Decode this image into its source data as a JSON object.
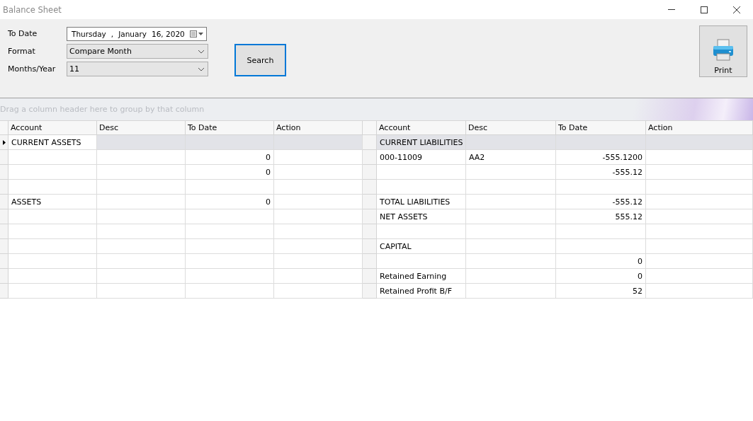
{
  "window": {
    "title": "Balance Sheet"
  },
  "filters": {
    "to_date": {
      "label": "To Date",
      "weekday": "Thursday",
      "separator": ",",
      "month": "January",
      "day_year": "16, 2020"
    },
    "format": {
      "label": "Format",
      "value": "Compare Month"
    },
    "months": {
      "label": "Months/Year",
      "value": "11"
    }
  },
  "search_button": {
    "label": "Search",
    "focused": true
  },
  "print_button": {
    "label": "Print"
  },
  "group_panel": {
    "placeholder": "Drag a column header here to group by that column"
  },
  "grids": [
    {
      "columns": [
        "Account",
        "Desc",
        "To Date",
        "Action"
      ],
      "focused": true,
      "rows": [
        {
          "selected": true,
          "account": "CURRENT ASSETS"
        },
        {
          "selected": false,
          "to_date": "0"
        },
        {
          "selected": false,
          "to_date": "0"
        },
        {
          "selected": false
        },
        {
          "selected": false,
          "account": "ASSETS",
          "to_date": "0"
        },
        {
          "selected": false
        },
        {
          "selected": false
        },
        {
          "selected": false
        },
        {
          "selected": false
        },
        {
          "selected": false
        },
        {
          "selected": false
        }
      ]
    },
    {
      "columns": [
        "Account",
        "Desc",
        "To Date",
        "Action"
      ],
      "focused": false,
      "rows": [
        {
          "selected": true,
          "account": "CURRENT LIABILITIES"
        },
        {
          "selected": false,
          "account": "000-11009",
          "desc": "AA2",
          "to_date": "-555.1200"
        },
        {
          "selected": false,
          "to_date": "-555.12"
        },
        {
          "selected": false
        },
        {
          "selected": false,
          "account": "TOTAL LIABILITIES",
          "to_date": "-555.12"
        },
        {
          "selected": false,
          "account": "NET ASSETS",
          "to_date": "555.12"
        },
        {
          "selected": false
        },
        {
          "selected": false,
          "account": "CAPITAL"
        },
        {
          "selected": false,
          "to_date": "0"
        },
        {
          "selected": false,
          "account": "Retained Earning",
          "to_date": "0"
        },
        {
          "selected": false,
          "account": "Retained Profit B/F",
          "to_date": "52"
        }
      ]
    }
  ]
}
